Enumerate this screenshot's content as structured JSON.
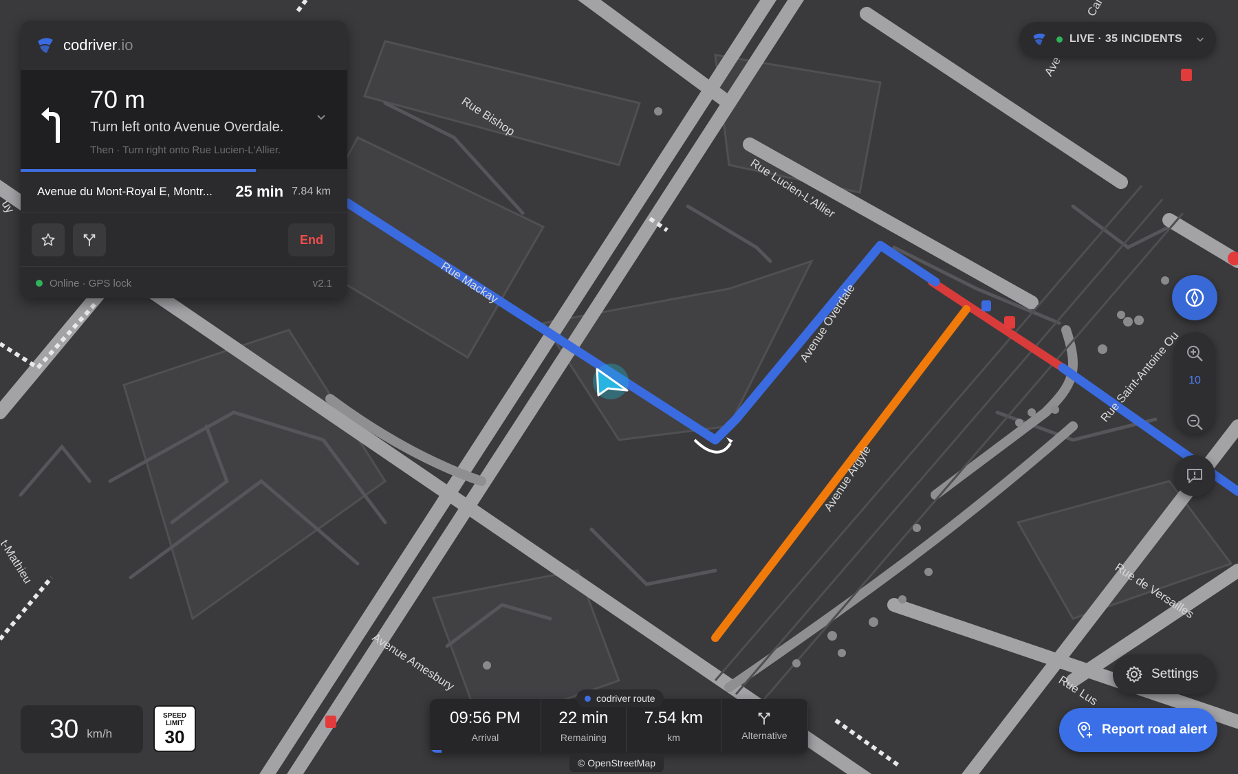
{
  "brand": {
    "name": "codriver",
    "tld": ".io"
  },
  "navigation": {
    "distance": "70 m",
    "instruction": "Turn left onto Avenue Overdale.",
    "then": "Then · Turn right onto Rue Lucien-L'Allier.",
    "step_progress": 0.72
  },
  "route": {
    "destination": "Avenue du Mont-Royal E, Montr...",
    "eta": "25 min",
    "distance": "7.84 km"
  },
  "actions": {
    "end_label": "End"
  },
  "status": {
    "text": "Online · GPS lock",
    "version": "v2.1"
  },
  "live": {
    "text": "LIVE · 35 INCIDENTS"
  },
  "zoom": {
    "level": "10"
  },
  "settings": {
    "label": "Settings"
  },
  "report": {
    "label": "Report road alert"
  },
  "speed": {
    "value": "30",
    "unit": "km/h",
    "limit_title": "SPEED\nLIMIT",
    "limit_top1": "SPEED",
    "limit_top2": "LIMIT",
    "limit": "30"
  },
  "trip": {
    "route_tag": "codriver route",
    "arrival": {
      "value": "09:56 PM",
      "label": "Arrival"
    },
    "remaining": {
      "value": "22 min",
      "label": "Remaining"
    },
    "km": {
      "value": "7.54 km",
      "label": "km"
    },
    "alternative": {
      "label": "Alternative"
    },
    "progress": 0.03
  },
  "attribution": "© OpenStreetMap",
  "map": {
    "street_labels": [
      "Rue Bishop",
      "Rue Mackay",
      "Rue Lucien-L'Allier",
      "Avenue Overdale",
      "Avenue Argyle",
      "Rue Saint-Antoine Ou",
      "Rue de Versailles",
      "Avenue Amesbury",
      "Rue Lus",
      "t-Mathieu",
      "Ave",
      "Can",
      "uy"
    ],
    "colors": {
      "route": "#3b6be0",
      "alternative": "#f07a0a",
      "congestion": "#d93b3b",
      "background": "#3a3a3c"
    }
  }
}
